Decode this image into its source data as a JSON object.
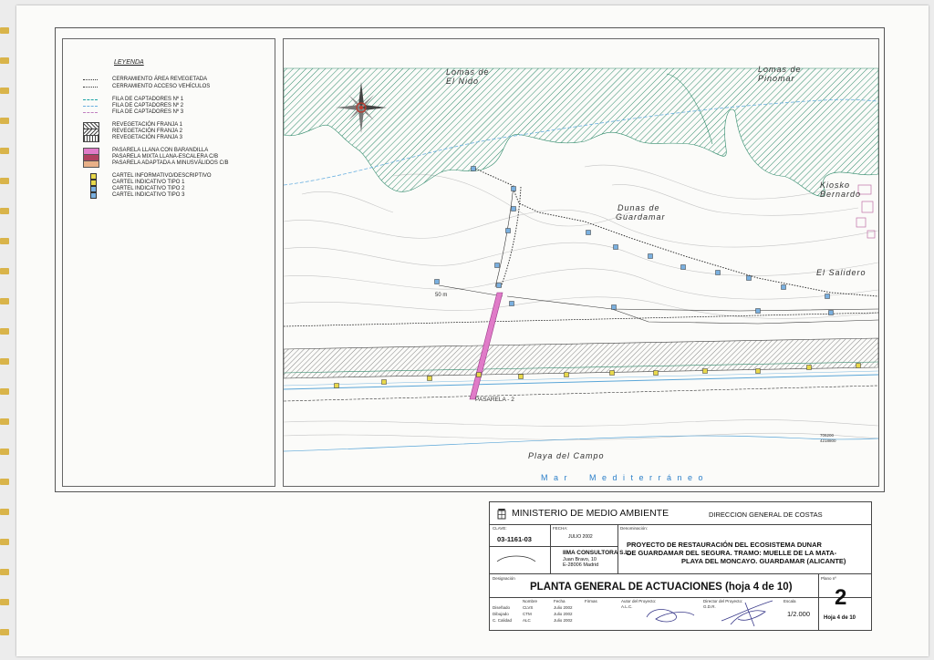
{
  "legend": {
    "title": "LEYENDA",
    "items": [
      {
        "label": "CERRAMIENTO ÁREA REVEGETADA",
        "symbol": "fence",
        "color": "#333333"
      },
      {
        "label": "CERRAMIENTO ACCESO VEHÍCULOS",
        "symbol": "dotted",
        "color": "#333333"
      },
      {
        "label": "FILA DE CAPTADORES Nº 1",
        "symbol": "dashed",
        "color": "#1aa3a3"
      },
      {
        "label": "FILA DE CAPTADORES Nº 2",
        "symbol": "dashed",
        "color": "#6ab0e0"
      },
      {
        "label": "FILA DE CAPTADORES Nº 3",
        "symbol": "dashed",
        "color": "#c080c0"
      },
      {
        "label": "REVEGETACIÓN FRANJA 1",
        "symbol": "hatch",
        "color": "#444444"
      },
      {
        "label": "REVEGETACIÓN FRANJA 2",
        "symbol": "hatch2",
        "color": "#444444"
      },
      {
        "label": "REVEGETACIÓN FRANJA 3",
        "symbol": "grid",
        "color": "#444444"
      },
      {
        "label": "PASARELA LLANA CON BARANDILLA",
        "symbol": "fill",
        "color": "#e07bc8"
      },
      {
        "label": "PASARELA MIXTA LLANA-ESCALERA C/B",
        "symbol": "fill",
        "color": "#b04060"
      },
      {
        "label": "PASARELA ADAPTADA A MINUSVÁLIDOS C/B",
        "symbol": "fill",
        "color": "#e8b088"
      },
      {
        "label": "CARTEL INFORMATIVO/DESCRIPTIVO",
        "symbol": "square",
        "color": "#e8d84a"
      },
      {
        "label": "CARTEL INDICATIVO TIPO 1",
        "symbol": "square",
        "color": "#e8d84a"
      },
      {
        "label": "CARTEL INDICATIVO TIPO 2",
        "symbol": "square",
        "color": "#7ab0e0"
      },
      {
        "label": "CARTEL INDICATIVO TIPO 3",
        "symbol": "square",
        "color": "#7ab0e0"
      }
    ]
  },
  "map": {
    "labels": {
      "lomas_nido_1": "Lomas de",
      "lomas_nido_2": "El Nido",
      "lomas_pinomar_1": "Lomas de",
      "lomas_pinomar_2": "Pinomar",
      "dunas_1": "Dunas de",
      "dunas_2": "Guardamar",
      "kiosko_1": "Kiosko",
      "kiosko_2": "Bernardo",
      "salidero": "El Salidero",
      "distance": "50 m",
      "pasarela": "PASARELA - 2",
      "playa": "Playa del Campo",
      "mar": "M a r     M e d i t e r r á n e o",
      "coord_x": "706200",
      "coord_y": "4218800"
    },
    "colors": {
      "hatch_green": "#2f8a6a",
      "shore_blue": "#5aa6d8",
      "pasarela_pink": "#e07bc8",
      "sign_yellow": "#e8d84a",
      "sign_blue": "#7ab0e0",
      "contour": "#b9b9b9"
    }
  },
  "titleblock": {
    "ministry": "MINISTERIO DE MEDIO AMBIENTE",
    "direction": "DIRECCION GENERAL DE COSTAS",
    "clave_label": "CLAVE:",
    "clave": "03-1161-03",
    "fecha_label": "FECHA:",
    "fecha": "JULIO 2002",
    "denominacion_label": "Denominación:",
    "consultora": "IIMA CONSULTORA S.L.",
    "address1": "Juan Bravo, 10",
    "address2": "E-28006 Madrid",
    "project1": "PROYECTO DE RESTAURACIÓN DEL ECOSISTEMA DUNAR",
    "project2": "DE GUARDAMAR DEL SEGURA. TRAMO: MUELLE DE LA MATA-",
    "project3": "PLAYA DEL MONCAYO. GUARDAMAR (ALICANTE)",
    "designacion_label": "Designación",
    "designacion": "PLANTA GENERAL DE ACTUACIONES (hoja 4 de 10)",
    "plano_label": "Plano nº",
    "plano_num": "2",
    "hoja": "Hoja  4  de 10",
    "nombre_label": "Nombre",
    "fecha_col_label": "Fecha",
    "firmas_label": "Firmas",
    "diseñado_label": "Diseñado",
    "dibujado_label": "Dibujado",
    "calidad_label": "C. Calidad",
    "diseñado": "CLVS",
    "dibujado": "CTM",
    "calidad": "ALC",
    "fecha_row": "Julio 2002",
    "autor_label": "Autor del Proyecto:",
    "autor": "A.L.C.",
    "director_label": "Director del Proyecto:",
    "director": "G.D.R.",
    "escala_label": "Escala",
    "escala": "1/2.000"
  }
}
